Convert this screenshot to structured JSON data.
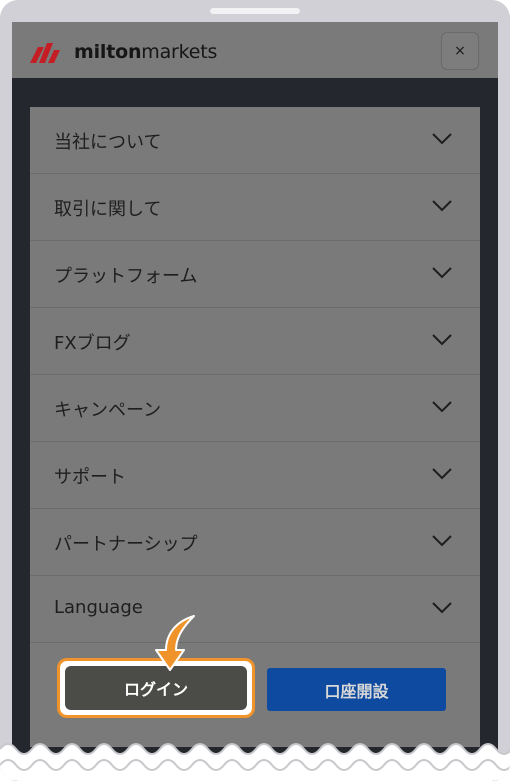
{
  "header": {
    "logo_bold": "milton",
    "logo_light": "markets",
    "close_label": "×"
  },
  "menu": {
    "items": [
      {
        "label": "当社について"
      },
      {
        "label": "取引に関して"
      },
      {
        "label": "プラットフォーム"
      },
      {
        "label": "FXブログ"
      },
      {
        "label": "キャンペーン"
      },
      {
        "label": "サポート"
      },
      {
        "label": "パートナーシップ"
      },
      {
        "label": "Language"
      }
    ]
  },
  "buttons": {
    "login_label": "ログイン",
    "open_account_label": "口座開設"
  },
  "colors": {
    "brand_red": "#c41e24",
    "highlight_orange": "#f0932b",
    "primary_blue": "#0d4aa0",
    "overlay_gray": "#7a7a7a"
  },
  "icons": {
    "close": "close-icon",
    "chevron": "chevron-down-icon",
    "pointer": "arrow-pointer-icon"
  }
}
